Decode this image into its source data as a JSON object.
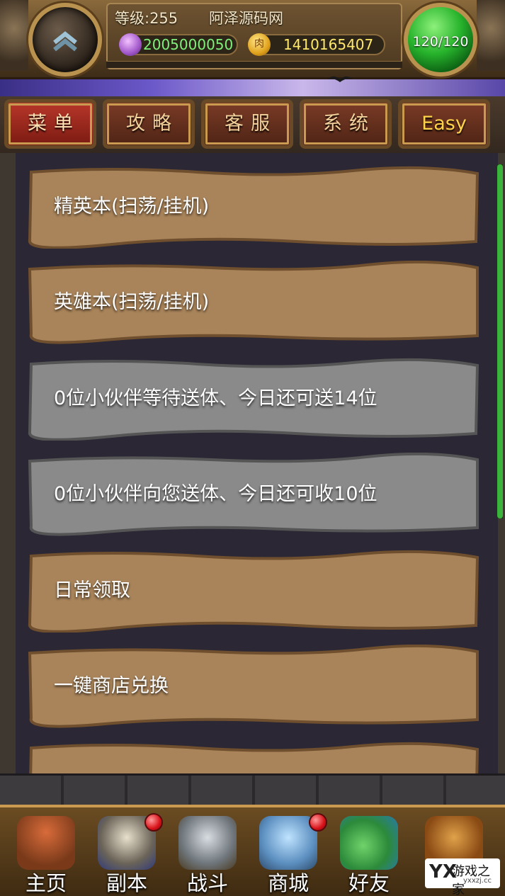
{
  "hud": {
    "level": "等级:255",
    "server": "阿泽源码网",
    "gems": "2005000050",
    "gold": "1410165407",
    "stamina": "120/120",
    "gold_icon_glyph": "肉",
    "icons": {
      "upgrade": "double-chevron-up",
      "gem": "purple-gem",
      "gold": "gold-coin",
      "stamina": "green-orb"
    }
  },
  "tabs": [
    {
      "label": "菜单",
      "active": true
    },
    {
      "label": "攻略",
      "active": false
    },
    {
      "label": "客服",
      "active": false
    },
    {
      "label": "系统",
      "active": false
    },
    {
      "label": "Easy",
      "active": false
    }
  ],
  "menu_items": [
    {
      "label": "精英本(扫荡/挂机)",
      "style": "wood"
    },
    {
      "label": "英雄本(扫荡/挂机)",
      "style": "wood"
    },
    {
      "label": "0位小伙伴等待送体、今日还可送14位",
      "style": "stone"
    },
    {
      "label": "0位小伙伴向您送体、今日还可收10位",
      "style": "stone"
    },
    {
      "label": "日常领取",
      "style": "wood"
    },
    {
      "label": "一键商店兑换",
      "style": "wood"
    },
    {
      "label": "",
      "style": "wood"
    }
  ],
  "bottom_nav": [
    {
      "label": "主页",
      "icon": "house-icon",
      "badge": false
    },
    {
      "label": "副本",
      "icon": "skull-icon",
      "badge": true
    },
    {
      "label": "战斗",
      "icon": "swords-icon",
      "badge": false
    },
    {
      "label": "商城",
      "icon": "monster-shop-icon",
      "badge": true
    },
    {
      "label": "好友",
      "icon": "friends-icon",
      "badge": false
    },
    {
      "label": "",
      "icon": "book-icon",
      "badge": false
    }
  ],
  "watermark": {
    "logo": "YX",
    "name": "游戏之家",
    "domain": "yxxzj.cc"
  },
  "colors": {
    "wood": "#a9845a",
    "wood_dark": "#6f4f2e",
    "stone": "#8a8a8a",
    "stone_dark": "#555555",
    "tab_active": "#b8362a",
    "gem_text": "#7ef07a",
    "gold_text": "#ffe96b",
    "scrollbar": "#3bb43b"
  }
}
